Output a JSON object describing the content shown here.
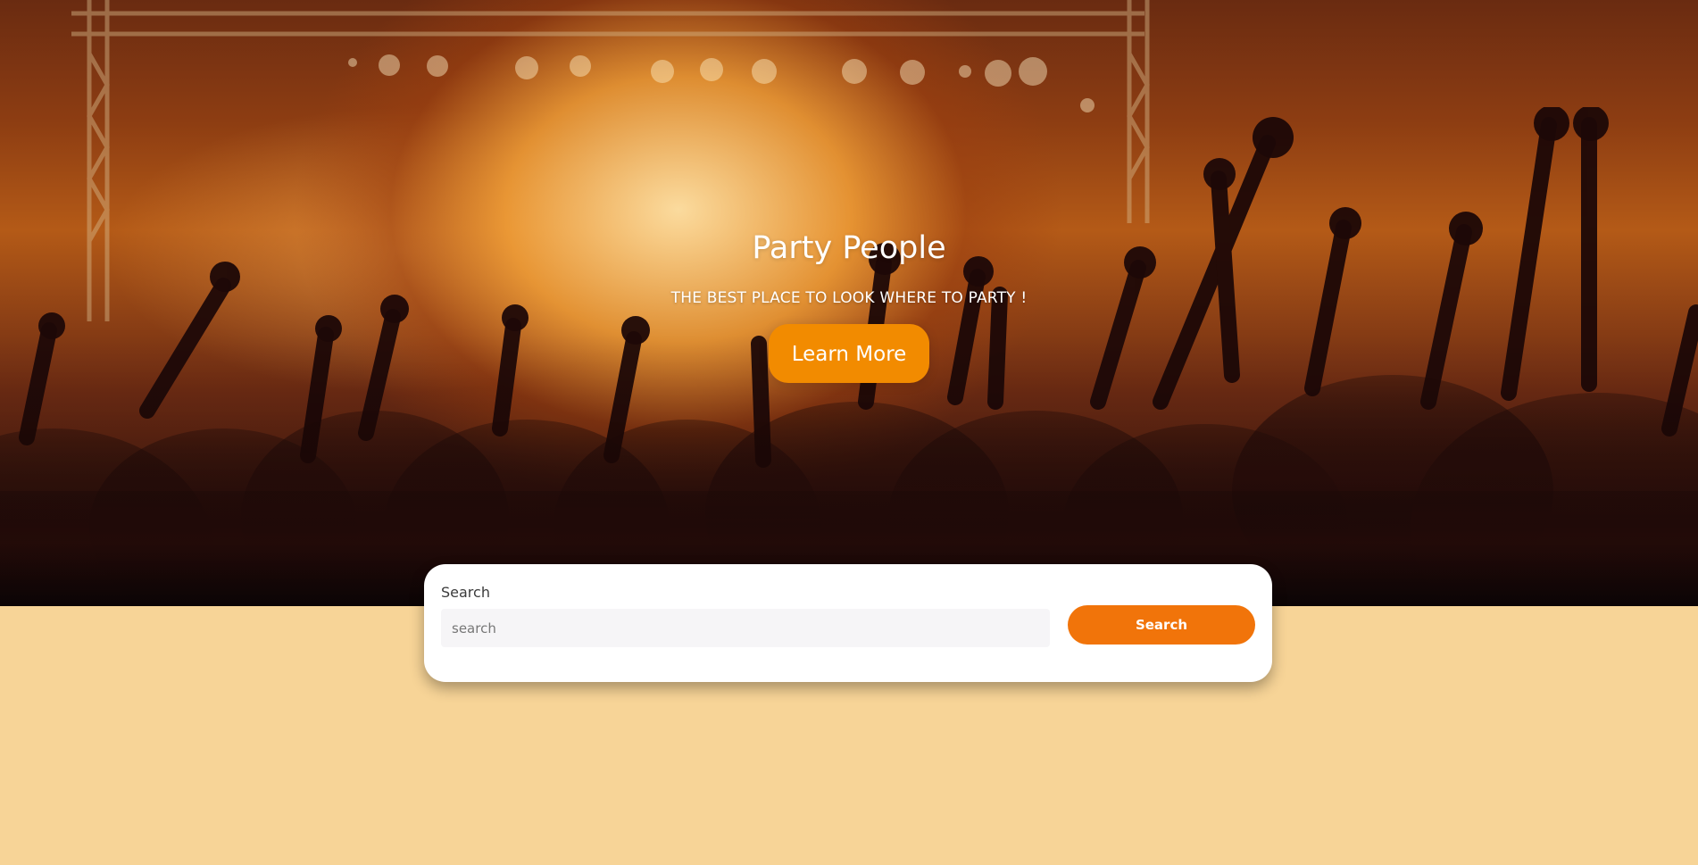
{
  "hero": {
    "title": "Party People",
    "subtitle": "THE BEST PLACE TO LOOK WHERE TO PARTY !",
    "cta_label": "Learn More",
    "background_image": "concert-crowd-stage-lights"
  },
  "search": {
    "label": "Search",
    "placeholder": "search",
    "button_label": "Search"
  },
  "colors": {
    "page_background": "#f7d497",
    "primary_button": "#f28b00",
    "search_button": "#f1740a",
    "card_background": "#ffffff"
  }
}
